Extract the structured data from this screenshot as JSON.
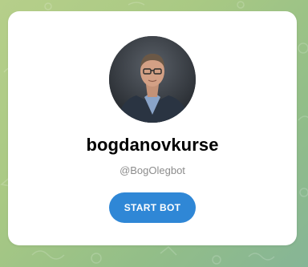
{
  "profile": {
    "name": "bogdanovkurse",
    "username": "@BogOlegbot",
    "avatar_icon": "bot-avatar-photo"
  },
  "actions": {
    "start_label": "START BOT"
  },
  "colors": {
    "background_start": "#b6cf8a",
    "background_end": "#86b596",
    "card": "#ffffff",
    "button": "#2f87d6",
    "username_text": "#8c8c8c"
  }
}
